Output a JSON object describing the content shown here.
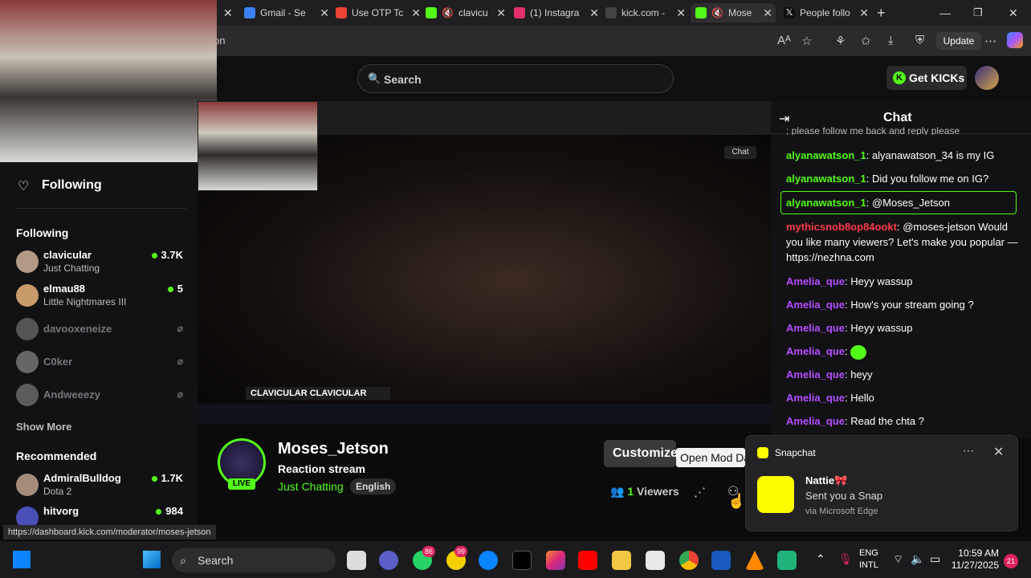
{
  "browser": {
    "tabs": [
      {
        "label": "Gmail - Se",
        "icon": "gmail-icon",
        "color": "#3b82f6"
      },
      {
        "label": "Use OTP Tc",
        "icon": "gmail-m-icon",
        "color": "#ea4335"
      },
      {
        "label": "clavicu",
        "icon": "kick-icon",
        "color": "#53fc18"
      },
      {
        "label": "(1) Instagra",
        "icon": "instagram-icon",
        "color": "#e1306c"
      },
      {
        "label": "kick.com -",
        "icon": "search-icon",
        "color": "#888888"
      },
      {
        "label": "Mose",
        "icon": "kick-icon",
        "color": "#53fc18"
      },
      {
        "label": "People follo",
        "icon": "x-icon",
        "color": "#ffffff"
      }
    ],
    "url_visible": "on",
    "update_label": "Update"
  },
  "kick": {
    "search_placeholder": "Search",
    "get_kicks_label": "Get KICKs",
    "accent": "#53fc18"
  },
  "sidebar": {
    "following_title": "Following",
    "following_section": "Following",
    "following": [
      {
        "name": "clavicular",
        "game": "Just Chatting",
        "count": "3.7K",
        "live": true
      },
      {
        "name": "elmau88",
        "game": "Little Nightmares III",
        "count": "5",
        "live": true
      },
      {
        "name": "davooxeneize",
        "game": "",
        "count": "",
        "live": false
      },
      {
        "name": "C0ker",
        "game": "",
        "count": "",
        "live": false
      },
      {
        "name": "Andweeezy",
        "game": "",
        "count": "",
        "live": false
      }
    ],
    "show_more": "Show More",
    "recommended_title": "Recommended",
    "recommended": [
      {
        "name": "AdmiralBulldog",
        "game": "Dota 2",
        "count": "1.7K",
        "live": true
      },
      {
        "name": "hitvorg",
        "game": "",
        "count": "984",
        "live": true
      }
    ]
  },
  "video": {
    "overlay_tag": "CLAVICULAR CLAVICULAR",
    "chat_chip": "Chat"
  },
  "stream": {
    "streamer": "Moses_Jetson",
    "title": "Reaction stream",
    "category": "Just Chatting",
    "language": "English",
    "live_label": "LIVE",
    "customize_label": "Customize",
    "tooltip": "Open Mod Da",
    "viewer_count": "1",
    "viewer_label": "Viewers"
  },
  "chat": {
    "title": "Chat",
    "truncated_top": "; please follow me back and reply please",
    "messages": [
      {
        "user": "alyanawatson_1",
        "text": ": alyanawatson_34 is my IG",
        "color": "green"
      },
      {
        "user": "alyanawatson_1",
        "text": ": Did you follow me on IG?",
        "color": "green"
      },
      {
        "user": "alyanawatson_1",
        "text": ": @Moses_Jetson",
        "color": "green"
      },
      {
        "user": "mythicsnob8op84ookt",
        "text": ": @moses-jetson Would you like many viewers? Let's make you popular — https://nezhna.com",
        "color": "red"
      },
      {
        "user": "Amelia_que",
        "text": ": Heyy wassup",
        "color": "purple"
      },
      {
        "user": "Amelia_que",
        "text": ": How's your stream going ?",
        "color": "purple"
      },
      {
        "user": "Amelia_que",
        "text": ": Heyy wassup",
        "color": "purple"
      },
      {
        "user": "Amelia_que",
        "text": ": ",
        "color": "purple"
      },
      {
        "user": "Amelia_que",
        "text": ": heyy",
        "color": "purple"
      },
      {
        "user": "Amelia_que",
        "text": ": Hello",
        "color": "purple"
      },
      {
        "user": "Amelia_que",
        "text": ": Read the chta ?",
        "color": "purple"
      }
    ]
  },
  "toast": {
    "app": "Snapchat",
    "sender": "Nattie🎀",
    "text": "Sent you a Snap",
    "via": "via Microsoft Edge"
  },
  "status_url": "https://dashboard.kick.com/moderator/moses-jetson",
  "taskbar": {
    "search": "Search",
    "lang1": "ENG",
    "lang2": "INTL",
    "time": "10:59 AM",
    "date": "11/27/2025",
    "badges": [
      "86",
      "99",
      "21"
    ]
  }
}
